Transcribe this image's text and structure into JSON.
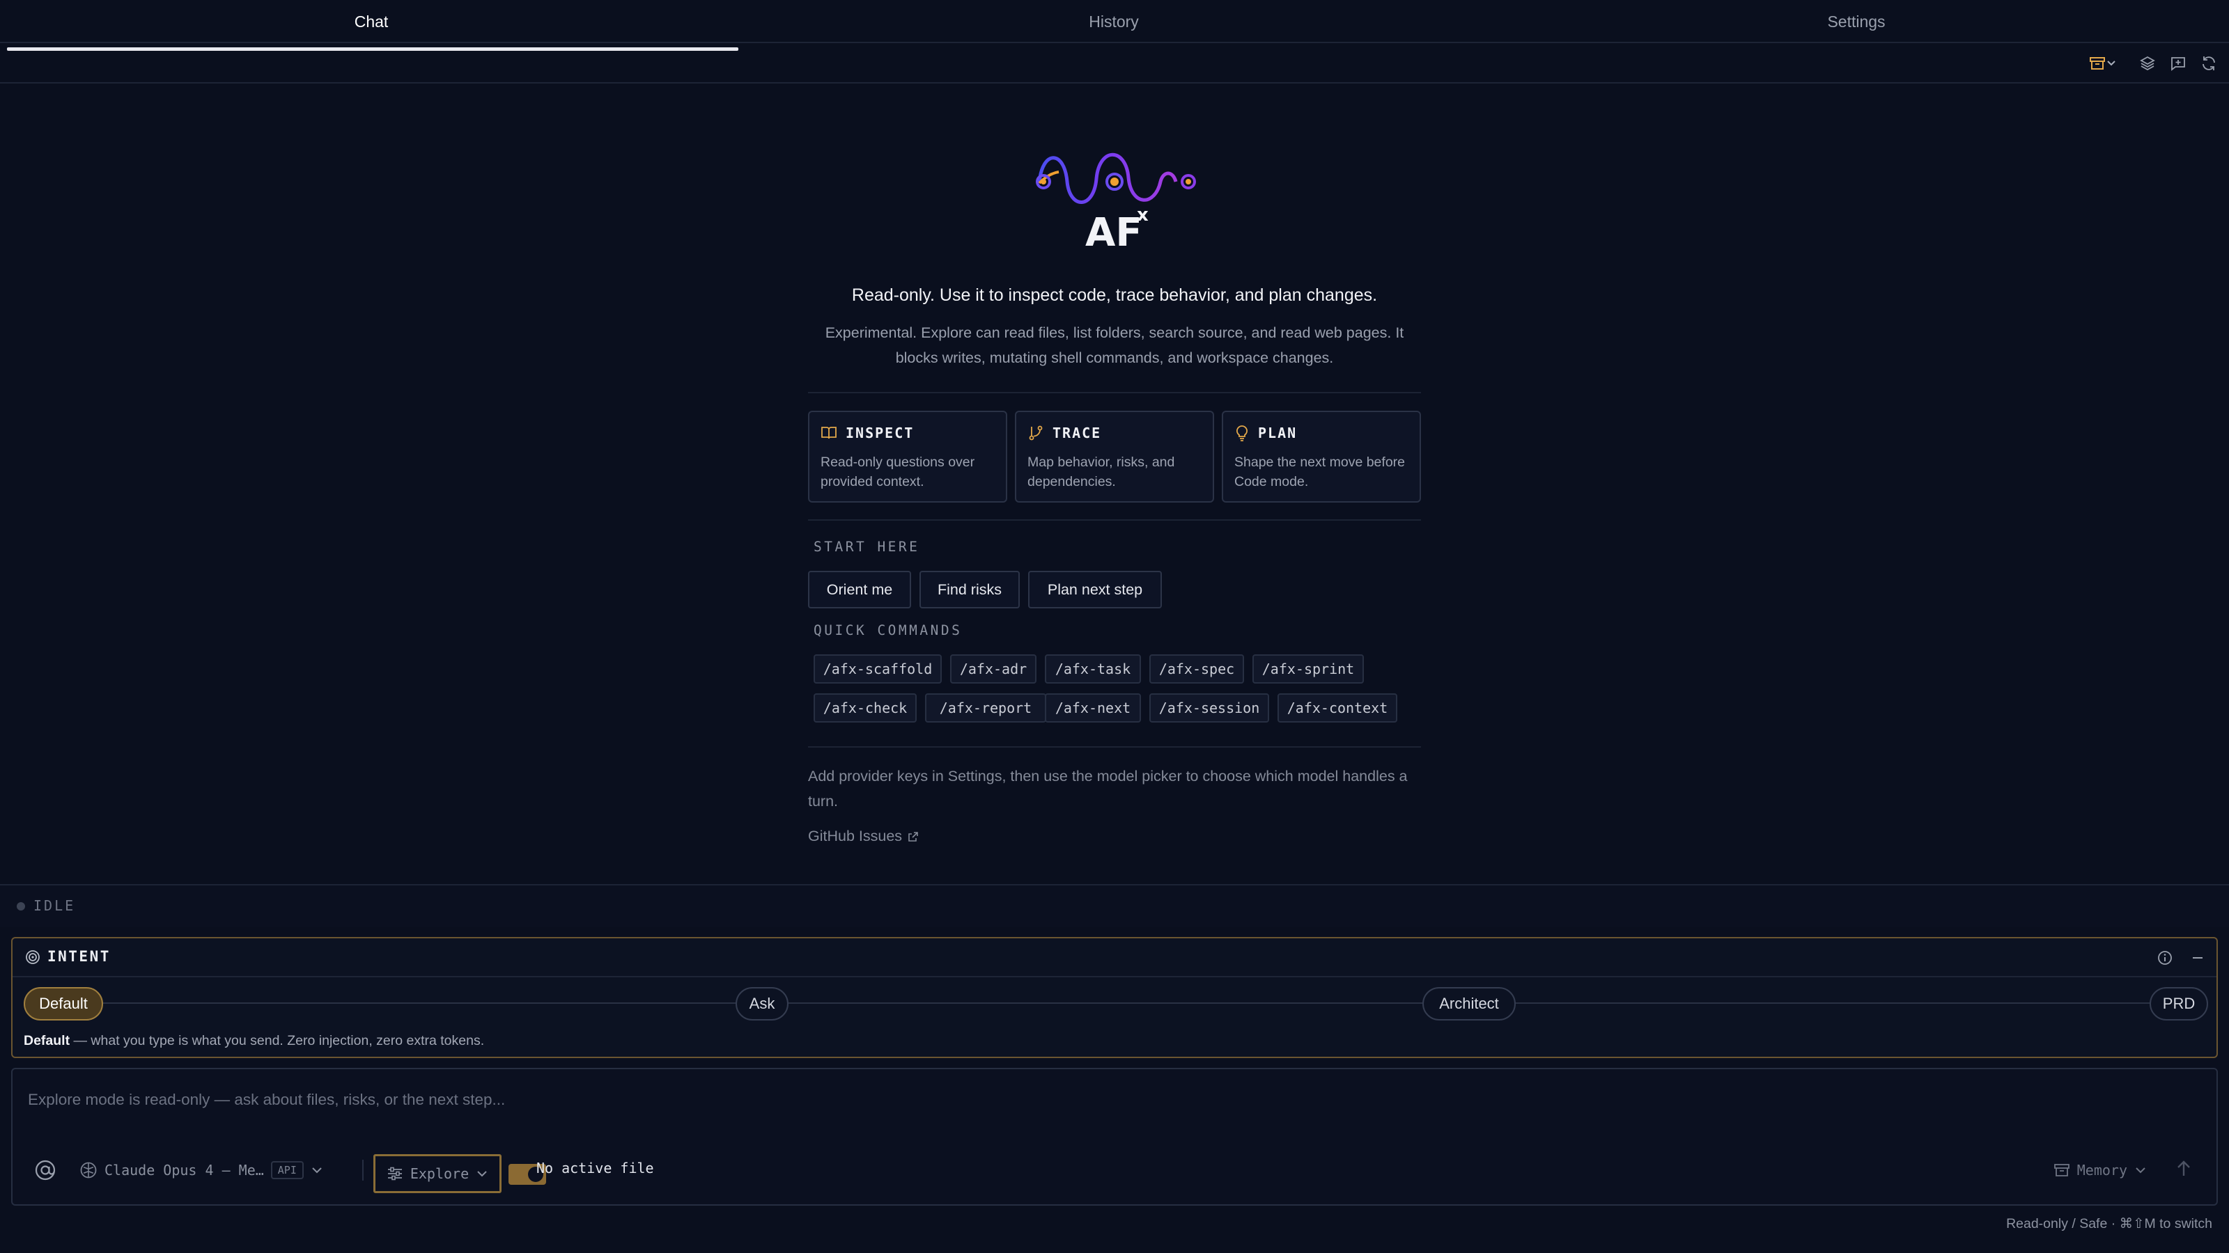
{
  "tabs": [
    {
      "label": "Chat",
      "active": true
    },
    {
      "label": "History",
      "active": false
    },
    {
      "label": "Settings",
      "active": false
    }
  ],
  "toolbar": {
    "icons": [
      "archive-icon",
      "chevron-down-icon",
      "layers-icon",
      "new-chat-icon",
      "refresh-icon"
    ]
  },
  "logo": {
    "text": "AF",
    "superscript": "x"
  },
  "hero": {
    "headline": "Read-only. Use it to inspect code, trace behavior, and plan changes.",
    "subline": "Experimental. Explore can read files, list folders, search source, and read web pages. It blocks writes, mutating shell commands, and workspace changes."
  },
  "cards": [
    {
      "title": "INSPECT",
      "icon": "book-icon",
      "desc": "Read-only questions over provided context."
    },
    {
      "title": "TRACE",
      "icon": "git-branch-icon",
      "desc": "Map behavior, risks, and dependencies."
    },
    {
      "title": "PLAN",
      "icon": "lightbulb-icon",
      "desc": "Shape the next move before Code mode."
    }
  ],
  "start_here": {
    "label": "START HERE",
    "chips": [
      "Orient me",
      "Find risks",
      "Plan next step"
    ]
  },
  "quick_commands": {
    "label": "QUICK COMMANDS",
    "row1": [
      "/afx-scaffold",
      "/afx-adr",
      "/afx-task",
      "/afx-spec",
      "/afx-sprint"
    ],
    "row2": [
      "/afx-check",
      "/afx-report",
      "/afx-next",
      "/afx-session",
      "/afx-context"
    ]
  },
  "hint": "Add provider keys in Settings, then use the model picker to choose which model handles a turn.",
  "github_link": "GitHub Issues",
  "status": {
    "text": "IDLE"
  },
  "intent": {
    "title": "INTENT",
    "options": [
      "Default",
      "Ask",
      "Architect",
      "PRD"
    ],
    "selected": "Default",
    "desc_strong": "Default",
    "desc_rest": " — what you type is what you send. Zero injection, zero extra tokens."
  },
  "composer": {
    "placeholder": "Explore mode is read-only — ask about files, risks, or the next step...",
    "model": "Claude Opus 4 – Me…",
    "model_badge": "API",
    "mode": "Explore",
    "active_file": "No active file",
    "memory": "Memory"
  },
  "footer": "Read-only / Safe · ⌘⇧M to switch",
  "colors": {
    "background": "#0a0f1e",
    "accent": "#a07f3e",
    "logo_purple": "#7a3cf0",
    "logo_orange": "#f0a030"
  }
}
